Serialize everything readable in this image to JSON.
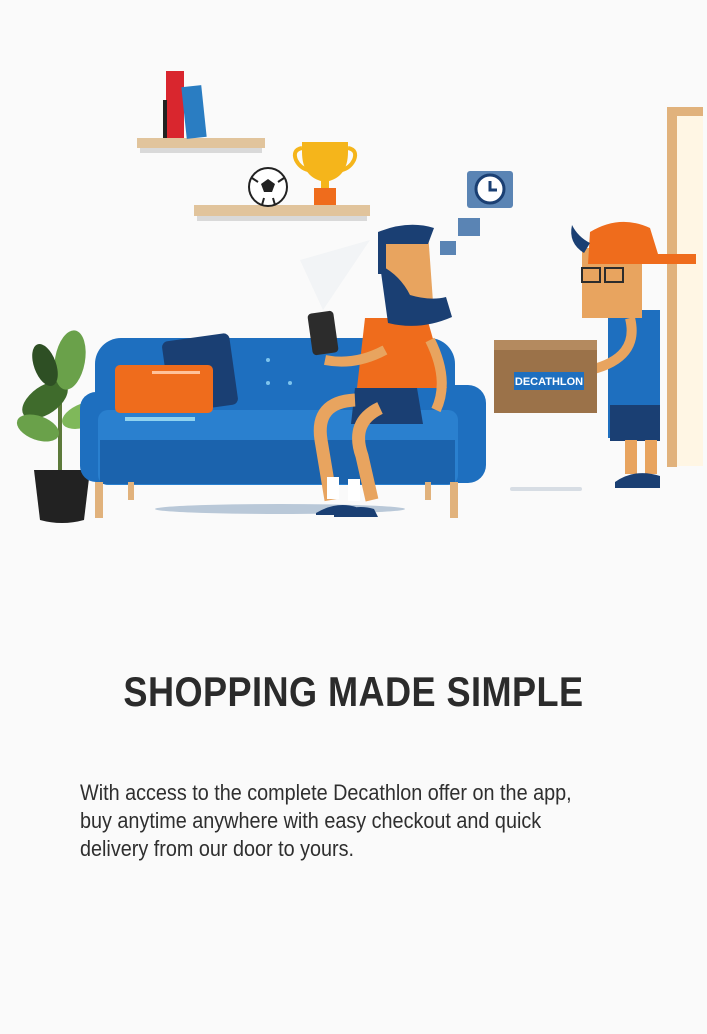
{
  "onboarding": {
    "illustration": {
      "box_brand_text": "DECATHLON",
      "icons": [
        "clock-icon",
        "trophy-icon",
        "soccer-ball-icon",
        "plant-icon",
        "smartphone-icon",
        "parcel-box-icon"
      ],
      "colors": {
        "sofa": "#1e6fbf",
        "orange": "#ef6c1c",
        "skin": "#e8a45f",
        "box": "#9b7249",
        "dark_blue": "#1a3f73"
      }
    },
    "title": "SHOPPING MADE SIMPLE",
    "description": "With access to the complete Decathlon offer on the app, buy anytime anywhere with easy checkout and quick delivery from our door to yours."
  }
}
